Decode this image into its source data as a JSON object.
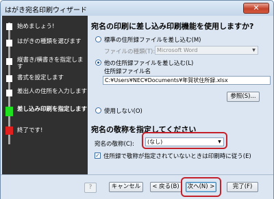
{
  "window": {
    "title": "はがき宛名印刷ウィザード",
    "close_glyph": "✕"
  },
  "steps": [
    {
      "label": "始めましょう!"
    },
    {
      "label": "はがきの種類を選びます"
    },
    {
      "label": "縦書き/横書きを指定します"
    },
    {
      "label": "書式を設定します"
    },
    {
      "label": "差出人の住所を入力します"
    },
    {
      "label": "差し込み印刷を指定します"
    },
    {
      "label": "終了です!"
    }
  ],
  "main": {
    "heading1": "宛名の印刷に差し込み印刷機能を使用しますか?",
    "option_standard": "標準の住所録ファイルを差し込む(M)",
    "file_type_label": "ファイルの種類(T):",
    "file_type_value": "Microsoft Word",
    "option_other": "他の住所録ファイルを差し込む(L)",
    "address_file_label": "住所録ファイル名",
    "address_file_path": "C:¥Users¥NEC¥Documents¥年賀状住所録.xlsx",
    "browse_button": "参照(S)...",
    "option_none": "使用しない(O)",
    "heading2": "宛名の敬称を指定してください",
    "honorific_label": "宛名の敬称(C):",
    "honorific_value": "(なし)",
    "checkbox_label": "住所録で敬称が指定されていないときは印刷時に従う(E)"
  },
  "footer": {
    "help": "?",
    "cancel": "キャンセル",
    "back": "< 戻る(B)",
    "next": "次へ(N) >",
    "finish": "完了(F)"
  },
  "colors": {
    "active_step": "#1ee01e",
    "end_step": "#e0201e",
    "highlight": "#c4202a"
  }
}
